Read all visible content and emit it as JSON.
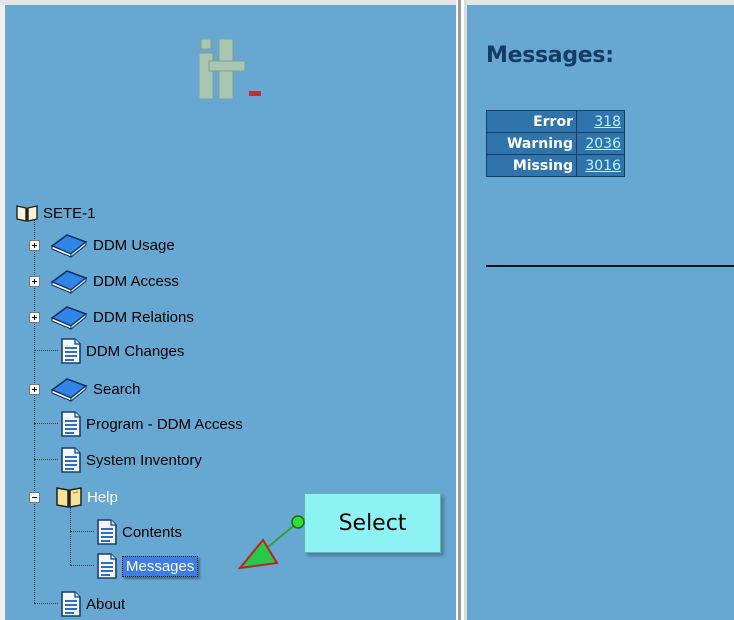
{
  "tree": {
    "root": "SETE-1",
    "items": [
      {
        "label": "DDM Usage",
        "icon": "book-icon",
        "expandable": true
      },
      {
        "label": "DDM Access",
        "icon": "book-icon",
        "expandable": true
      },
      {
        "label": "DDM Relations",
        "icon": "book-icon",
        "expandable": true
      },
      {
        "label": "DDM Changes",
        "icon": "document-icon",
        "expandable": false
      },
      {
        "label": "Search",
        "icon": "book-icon",
        "expandable": true
      },
      {
        "label": "Program - DDM Access",
        "icon": "document-icon",
        "expandable": false
      },
      {
        "label": "System Inventory",
        "icon": "document-icon",
        "expandable": false
      },
      {
        "label": "Help",
        "icon": "open-book-icon",
        "expandable": true,
        "expanded": true,
        "children": [
          {
            "label": "Contents",
            "icon": "document-icon"
          },
          {
            "label": "Messages",
            "icon": "document-icon",
            "selected": true
          }
        ]
      },
      {
        "label": "About",
        "icon": "document-icon",
        "expandable": false
      }
    ]
  },
  "main": {
    "title": "Messages:",
    "table": [
      {
        "key": "Error",
        "value": "318"
      },
      {
        "key": "Warning",
        "value": "2036"
      },
      {
        "key": "Missing",
        "value": "3016"
      }
    ]
  },
  "callout": {
    "text": "Select"
  },
  "colors": {
    "pane_bg": "#66a8d2",
    "title": "#153b64",
    "table_cell": "#2f74ad",
    "link": "#b6f4ff",
    "callout_bg": "#8cf3f2",
    "selection": "#3d7ee6"
  }
}
